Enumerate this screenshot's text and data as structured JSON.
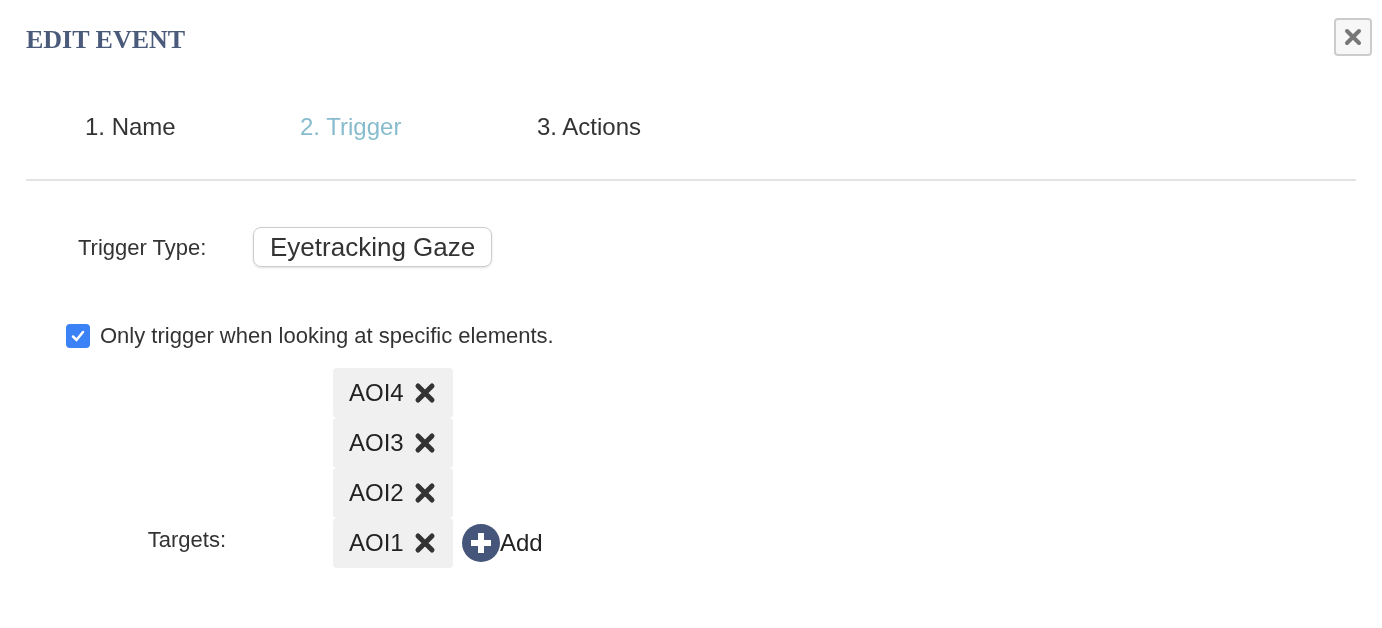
{
  "dialog": {
    "title": "EDIT EVENT"
  },
  "steps": [
    {
      "label": "1. Name",
      "selected": false
    },
    {
      "label": "2. Trigger",
      "selected": true
    },
    {
      "label": "3. Actions",
      "selected": false
    }
  ],
  "trigger_type": {
    "label": "Trigger Type:",
    "value": "Eyetracking Gaze"
  },
  "only_specific": {
    "label": "Only trigger when looking at specific elements.",
    "checked": true
  },
  "targets": {
    "label": "Targets:",
    "items": [
      "AOI4",
      "AOI3",
      "AOI2",
      "AOI1"
    ],
    "add_label": "Add"
  }
}
